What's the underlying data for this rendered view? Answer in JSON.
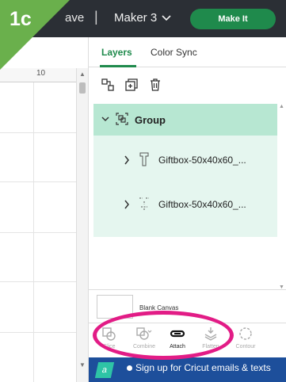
{
  "badge": {
    "label": "1c"
  },
  "header": {
    "save_label": "ave",
    "separator": "|",
    "machine": "Maker 3",
    "make_it": "Make It"
  },
  "canvas": {
    "ruler_label": "10"
  },
  "panel": {
    "tabs": [
      {
        "label": "Layers",
        "active": true
      },
      {
        "label": "Color Sync",
        "active": false
      }
    ],
    "toolbar_icons": [
      "group-icon",
      "duplicate-icon",
      "delete-icon"
    ],
    "layers": {
      "group_label": "Group",
      "items": [
        {
          "label": "Giftbox-50x40x60_..."
        },
        {
          "label": "Giftbox-50x40x60_..."
        }
      ]
    },
    "blank_canvas": "Blank Canvas",
    "actions": [
      {
        "label": "Slice",
        "enabled": false
      },
      {
        "label": "Combine",
        "enabled": false
      },
      {
        "label": "Attach",
        "enabled": true
      },
      {
        "label": "Flatten",
        "enabled": false
      },
      {
        "label": "Contour",
        "enabled": false
      }
    ]
  },
  "banner": {
    "tag": "a",
    "text": "Sign up for Cricut emails & texts"
  },
  "colors": {
    "topbar": "#2b2f35",
    "accent": "#1f8a4c",
    "highlight_ring": "#e21c86",
    "layer_bg": "#e5f6ef",
    "group_bg": "#b7e7d2",
    "banner": "#1d4f9b",
    "badge": "#6ab04c"
  }
}
